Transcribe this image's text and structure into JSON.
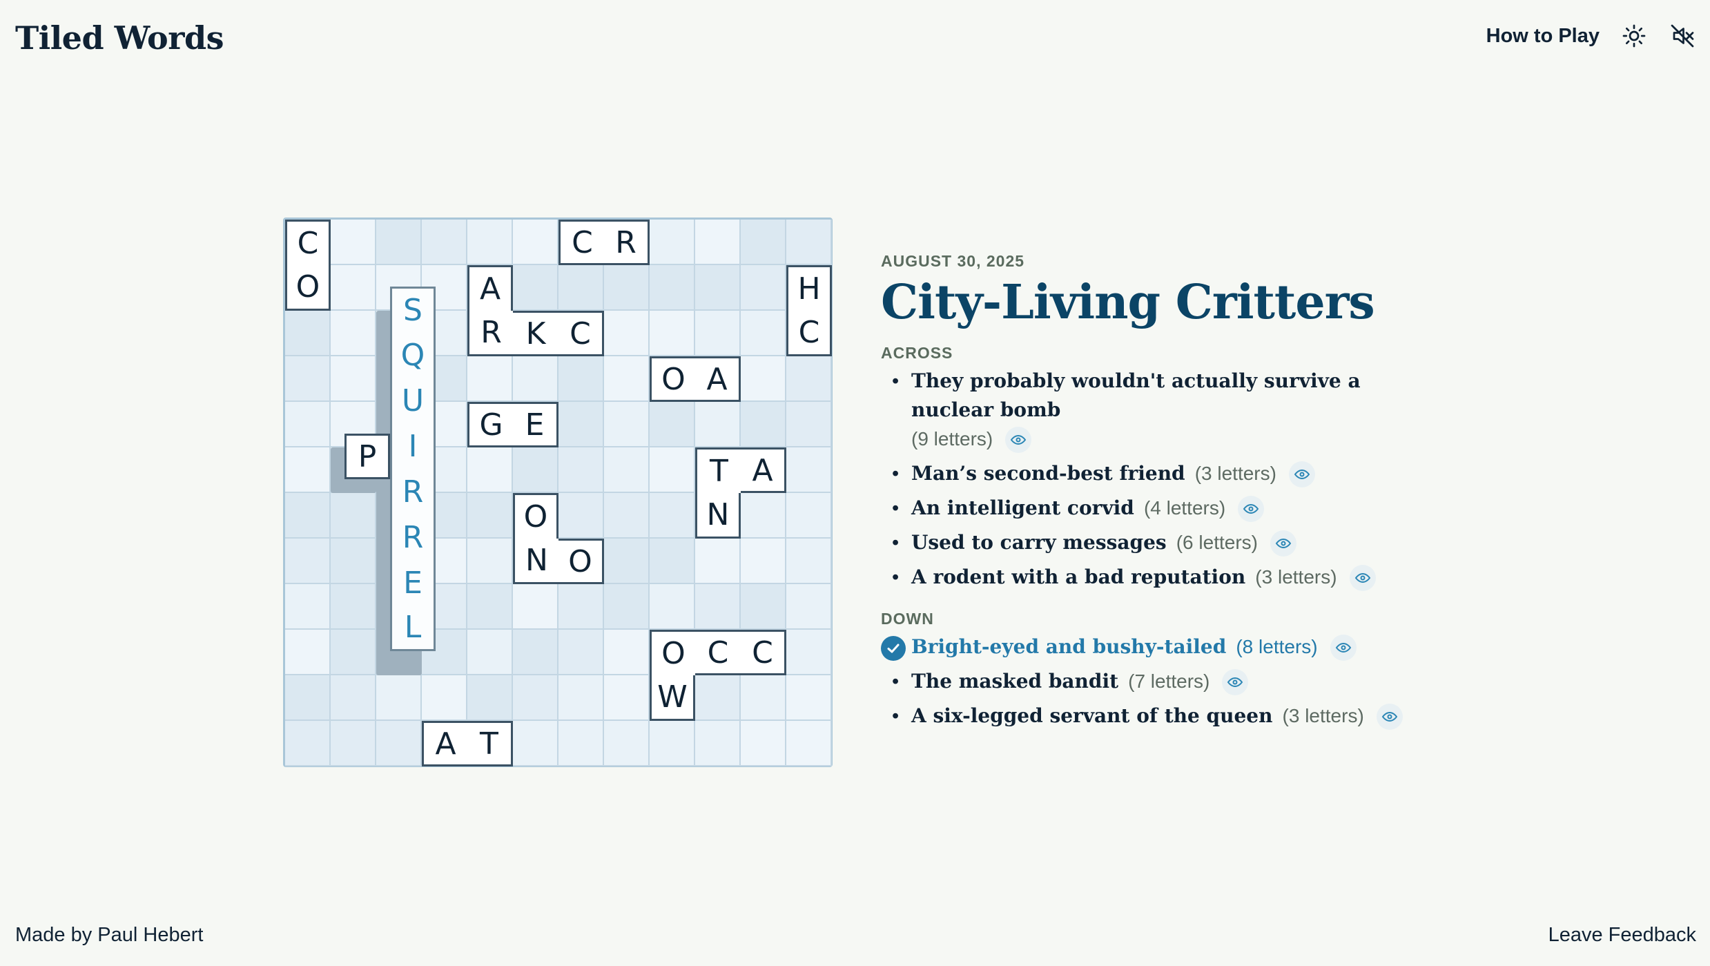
{
  "app": {
    "title": "Tiled Words"
  },
  "nav": {
    "how_to_play": "How to Play",
    "theme_icon": "sun-icon",
    "sound_icon": "speaker-muted-icon"
  },
  "puzzle": {
    "date": "AUGUST 30, 2025",
    "title": "City-Living Critters"
  },
  "across": {
    "heading": "ACROSS",
    "clues": [
      {
        "text": "They probably wouldn't actually survive a nuclear bomb",
        "count": "(9 letters)",
        "solved": false
      },
      {
        "text": "Man’s second-best friend",
        "count": "(3 letters)",
        "solved": false
      },
      {
        "text": "An intelligent corvid",
        "count": "(4 letters)",
        "solved": false
      },
      {
        "text": "Used to carry messages",
        "count": "(6 letters)",
        "solved": false
      },
      {
        "text": "A rodent with a bad reputation",
        "count": "(3 letters)",
        "solved": false
      }
    ]
  },
  "down": {
    "heading": "DOWN",
    "clues": [
      {
        "text": "Bright-eyed and bushy-tailed",
        "count": "(8 letters)",
        "solved": true
      },
      {
        "text": "The masked bandit",
        "count": "(7 letters)",
        "solved": false
      },
      {
        "text": "A six-legged servant of the queen",
        "count": "(3 letters)",
        "solved": false
      }
    ]
  },
  "board": {
    "rows": 12,
    "cols": 12,
    "tiles": [
      {
        "id": "t1",
        "cells": [
          [
            0,
            0,
            "C"
          ],
          [
            1,
            0,
            "O"
          ]
        ]
      },
      {
        "id": "t2",
        "cells": [
          [
            0,
            6,
            "C"
          ],
          [
            0,
            7,
            "R"
          ]
        ]
      },
      {
        "id": "t3",
        "cells": [
          [
            1,
            11,
            "H"
          ],
          [
            2,
            11,
            "C"
          ]
        ]
      },
      {
        "id": "t4",
        "cells": [
          [
            1,
            4,
            "A"
          ],
          [
            2,
            4,
            "R"
          ],
          [
            2,
            5,
            "K"
          ],
          [
            2,
            6,
            "C"
          ]
        ]
      },
      {
        "id": "t5",
        "cells": [
          [
            3,
            8,
            "O"
          ],
          [
            3,
            9,
            "A"
          ]
        ]
      },
      {
        "id": "t6",
        "cells": [
          [
            4,
            4,
            "G"
          ],
          [
            4,
            5,
            "E"
          ]
        ]
      },
      {
        "id": "t7",
        "cells": [
          [
            5,
            9,
            "T"
          ],
          [
            5,
            10,
            "A"
          ],
          [
            6,
            9,
            "N"
          ]
        ]
      },
      {
        "id": "t8",
        "cells": [
          [
            6,
            5,
            "O"
          ],
          [
            7,
            5,
            "N"
          ],
          [
            7,
            6,
            "O"
          ]
        ]
      },
      {
        "id": "t9",
        "cells": [
          [
            9,
            8,
            "O"
          ],
          [
            9,
            9,
            "C"
          ],
          [
            9,
            10,
            "C"
          ],
          [
            10,
            8,
            "W"
          ]
        ]
      },
      {
        "id": "t10",
        "cells": [
          [
            11,
            3,
            "A"
          ],
          [
            11,
            4,
            "T"
          ]
        ]
      },
      {
        "id": "t11",
        "cells": [
          [
            5,
            1,
            "P"
          ]
        ]
      }
    ],
    "solved_word": {
      "letters": [
        "S",
        "Q",
        "U",
        "I",
        "R",
        "R",
        "E",
        "L"
      ]
    }
  },
  "footer": {
    "credit": "Made by Paul Hebert",
    "feedback": "Leave Feedback"
  }
}
